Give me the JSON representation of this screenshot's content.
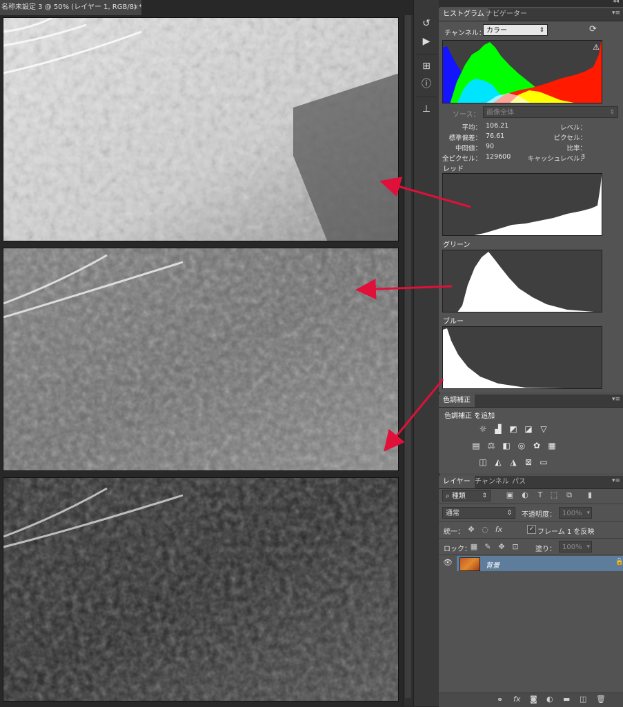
{
  "document": {
    "tab_title": "名称未設定 3 @ 50% (レイヤー 1, RGB/8) *",
    "close_symbol": "×"
  },
  "histogram_panel": {
    "tabs": [
      "ヒストグラム",
      "ナビゲーター"
    ],
    "channel_label": "チャンネル：",
    "channel_value": "カラー",
    "source_label": "ソース：",
    "source_value": "画像全体",
    "stats": {
      "mean_label": "平均：",
      "mean_value": "106.21",
      "std_label": "標準偏差：",
      "std_value": "76.61",
      "median_label": "中間値：",
      "median_value": "90",
      "pixels_label": "全ピクセル：",
      "pixels_value": "129600",
      "level_label": "レベル：",
      "level_value": "",
      "count_label": "ピクセル：",
      "count_value": "",
      "percentile_label": "比率：",
      "percentile_value": "",
      "cache_label": "キャッシュレベル：",
      "cache_value": "3"
    },
    "channels": [
      "レッド",
      "グリーン",
      "ブルー"
    ],
    "warning_symbol": "⚠"
  },
  "adjustments_panel": {
    "tab": "色調補正",
    "title": "色調補正 を追加"
  },
  "layers_panel": {
    "tabs": [
      "レイヤー",
      "チャンネル",
      "パス"
    ],
    "filter_kind": "種類",
    "blend_mode": "通常",
    "opacity_label": "不透明度：",
    "opacity_value": "100%",
    "unify_label": "統一：",
    "propagate_label": "フレーム 1 を反映",
    "lock_label": "ロック：",
    "fill_label": "塗り：",
    "fill_value": "100%",
    "layer_name": "背景",
    "visibility_symbol": "👁",
    "lock_symbol": "🔒"
  },
  "colors": {
    "annotation_arrow": "#e0103a",
    "layer_selected": "#5e7d9c"
  }
}
